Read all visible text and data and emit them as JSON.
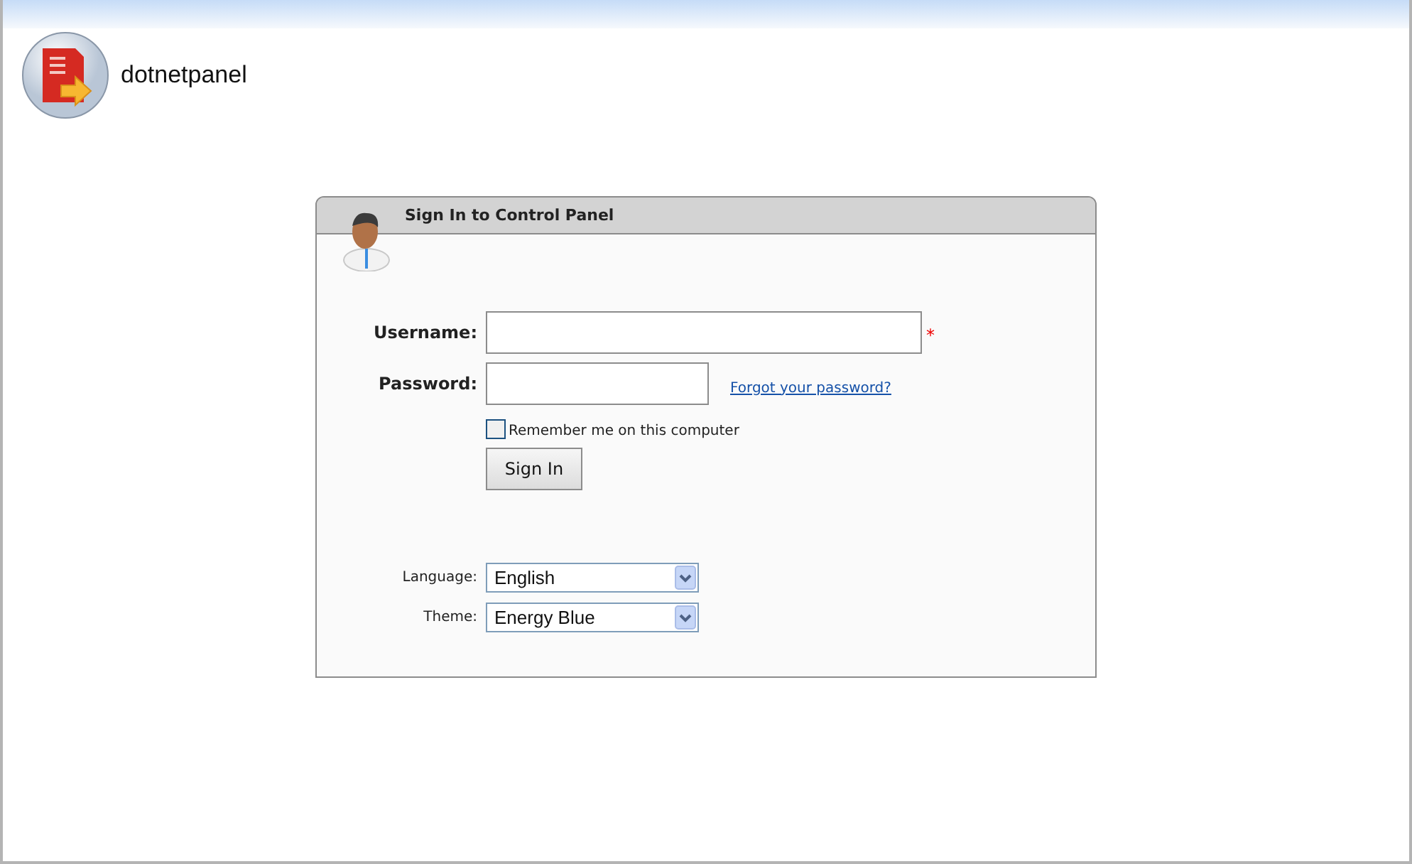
{
  "logo": {
    "text": "dotnetpanel"
  },
  "panel": {
    "title": "Sign In to Control Panel"
  },
  "fields": [
    {
      "label": "Username:",
      "required_mark": "*"
    },
    {
      "label": "Password:",
      "link": "Forgot your password?"
    }
  ],
  "remember": {
    "label": "Remember me on this computer",
    "checked": false
  },
  "button": "Sign In",
  "selects": [
    {
      "label": "Language:",
      "value": "English"
    },
    {
      "label": "Theme:",
      "value": "Energy Blue"
    }
  ]
}
